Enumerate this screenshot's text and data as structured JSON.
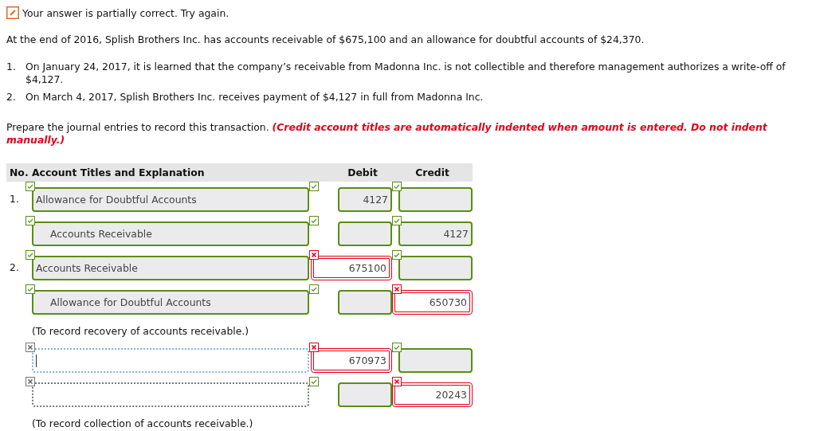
{
  "feedback": {
    "text": "Your answer is partially correct.  Try again."
  },
  "problem": "At the end of 2016, Splish Brothers Inc. has accounts receivable of $675,100 and an allowance for doubtful accounts of $24,370.",
  "events": [
    {
      "number": "1.",
      "text": "On January 24, 2017, it is learned that the company’s receivable from Madonna Inc. is not collectible and therefore management authorizes a write-off of $4,127."
    },
    {
      "number": "2.",
      "text": "On March 4, 2017, Splish Brothers Inc. receives payment of $4,127 in full from Madonna Inc."
    }
  ],
  "instruction": {
    "text": "Prepare the journal entries to record this transaction. ",
    "emphasis": "(Credit account titles are automatically indented when amount is entered. Do not indent manually.)"
  },
  "table": {
    "columns": [
      "No.",
      "Account Titles and Explanation",
      "Debit",
      "Credit"
    ],
    "rows": [
      {
        "kind": "line",
        "number": "1.",
        "indented": false,
        "account": {
          "value": "Allowance for Doubtful Accounts",
          "correct": true
        },
        "debit": {
          "value": "4127",
          "correct": true
        },
        "credit": {
          "correct": true
        }
      },
      {
        "kind": "line",
        "indented": true,
        "account": {
          "value": "Accounts Receivable",
          "correct": true
        },
        "debit": {
          "correct": true
        },
        "credit": {
          "value": "4127",
          "correct": true
        }
      },
      {
        "kind": "line",
        "number": "2.",
        "indented": false,
        "account": {
          "value": "Accounts Receivable",
          "correct": true
        },
        "debit": {
          "value": "675100",
          "correct": false
        },
        "credit": {
          "correct": true
        }
      },
      {
        "kind": "line",
        "indented": true,
        "account": {
          "value": "Allowance for Doubtful Accounts",
          "correct": true
        },
        "debit": {
          "correct": true
        },
        "credit": {
          "value": "650730",
          "correct": false
        }
      },
      {
        "kind": "note",
        "text": "(To record recovery of accounts receivable.)"
      },
      {
        "kind": "line",
        "focused": true,
        "account": {
          "correct": false
        },
        "debit": {
          "value": "670973",
          "correct": false
        },
        "credit": {
          "correct": true
        }
      },
      {
        "kind": "line",
        "focused": false,
        "account": {
          "correct": false
        },
        "debit": {
          "correct": true
        },
        "credit": {
          "value": "20243",
          "correct": false
        }
      },
      {
        "kind": "note",
        "text": "(To record collection of accounts receivable.)"
      }
    ]
  }
}
